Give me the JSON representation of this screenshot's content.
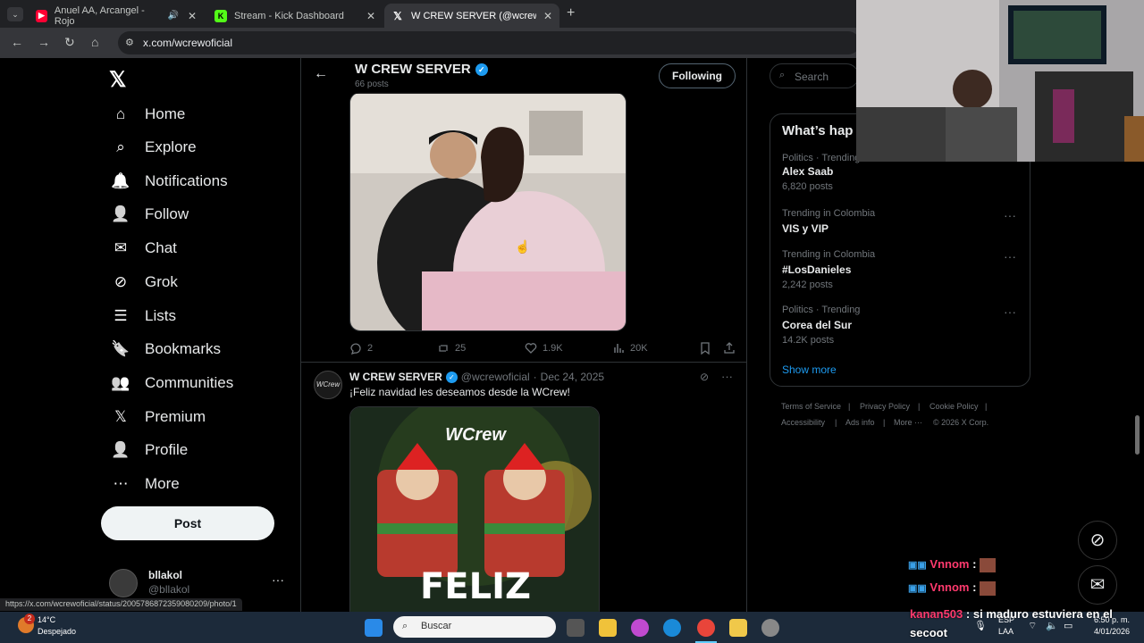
{
  "browser": {
    "tabs": [
      {
        "title": "Anuel AA, Arcangel - Rojo",
        "favicon": "youtube-icon",
        "color": "#ff0033"
      },
      {
        "title": "Stream - Kick Dashboard",
        "favicon": "kick-icon",
        "color": "#53fc18"
      },
      {
        "title": "W CREW SERVER (@wcrewofici",
        "favicon": "x-icon",
        "color": "#ffffff"
      }
    ],
    "url": "x.com/wcrewoficial",
    "status_url": "https://x.com/wcrewoficial/status/2005786872359080209/photo/1"
  },
  "sidebar": {
    "items": [
      {
        "label": "Home",
        "icon": "home-icon"
      },
      {
        "label": "Explore",
        "icon": "search-icon"
      },
      {
        "label": "Notifications",
        "icon": "bell-icon"
      },
      {
        "label": "Follow",
        "icon": "follow-icon"
      },
      {
        "label": "Chat",
        "icon": "mail-icon"
      },
      {
        "label": "Grok",
        "icon": "grok-icon"
      },
      {
        "label": "Lists",
        "icon": "list-icon"
      },
      {
        "label": "Bookmarks",
        "icon": "bookmark-icon"
      },
      {
        "label": "Communities",
        "icon": "communities-icon"
      },
      {
        "label": "Premium",
        "icon": "x-icon"
      },
      {
        "label": "Profile",
        "icon": "person-icon"
      },
      {
        "label": "More",
        "icon": "more-circle-icon"
      }
    ],
    "post_label": "Post",
    "account": {
      "name": "bllakol",
      "handle": "@bllakol"
    }
  },
  "profile_header": {
    "name": "W CREW SERVER",
    "posts": "66 posts",
    "following_label": "Following"
  },
  "tweet1": {
    "actions": {
      "replies": "2",
      "reposts": "25",
      "likes": "1.9K",
      "views": "20K"
    }
  },
  "tweet2": {
    "name": "W CREW SERVER",
    "handle": "@wcrewoficial",
    "date": "Dec 24, 2025",
    "text": "¡Feliz navidad les deseamos desde la WCrew!",
    "image_logo": "WCrew",
    "image_text": "FELIZ"
  },
  "right": {
    "search_placeholder": "Search",
    "whats_happening": "What’s hap",
    "trends": [
      {
        "meta": "Politics · Trending",
        "name": "Alex Saab",
        "count": "6,820 posts"
      },
      {
        "meta": "Trending in Colombia",
        "name": "VIS y VIP",
        "count": ""
      },
      {
        "meta": "Trending in Colombia",
        "name": "#LosDanieles",
        "count": "2,242 posts"
      },
      {
        "meta": "Politics · Trending",
        "name": "Corea del Sur",
        "count": "14.2K posts"
      }
    ],
    "show_more": "Show more",
    "footer": [
      "Terms of Service",
      "Privacy Policy",
      "Cookie Policy",
      "Accessibility",
      "Ads info",
      "More ···",
      "© 2026 X Corp."
    ]
  },
  "chat_overlay": [
    {
      "user": "Vnnom",
      "sep": ":",
      "msg": ""
    },
    {
      "user": "Vnnom",
      "sep": ":",
      "msg": ""
    },
    {
      "user": "kanan503",
      "sep": ":",
      "msg": "si maduro estuviera en el secoot"
    }
  ],
  "taskbar": {
    "weather_temp": "14°C",
    "weather_desc": "Despejado",
    "weather_badge": "2",
    "search_placeholder": "Buscar",
    "lang": "ESP",
    "lang2": "LAA",
    "time": "6:50 p. m.",
    "date": "4/01/2026"
  },
  "colors": {
    "accent": "#1d9bf0",
    "bg": "#000000",
    "border": "#2f3336",
    "muted": "#71767b"
  }
}
